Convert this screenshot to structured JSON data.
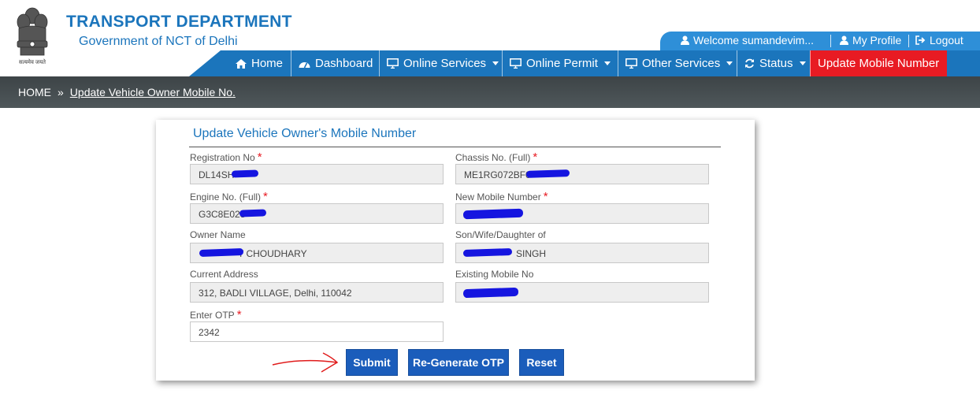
{
  "header": {
    "title": "TRANSPORT DEPARTMENT",
    "subtitle": "Government of NCT of Delhi",
    "emblem_caption": "सत्यमेव जयते"
  },
  "userbar": {
    "welcome": "Welcome  sumandevim...",
    "profile": "My Profile",
    "logout": "Logout"
  },
  "nav": {
    "home": "Home",
    "dashboard": "Dashboard",
    "online_services": "Online Services",
    "online_permit": "Online Permit",
    "other_services": "Other Services",
    "status": "Status",
    "update_mobile": "Update Mobile Number"
  },
  "breadcrumb": {
    "home": "HOME",
    "sep": "»",
    "current": "Update Vehicle Owner Mobile No."
  },
  "form": {
    "title": "Update Vehicle Owner's Mobile Number",
    "required_mark": "*",
    "fields": {
      "registration_no": {
        "label": "Registration No",
        "value": "DL14SH"
      },
      "chassis_no": {
        "label": "Chassis No. (Full)",
        "value": "ME1RG072BF0"
      },
      "engine_no": {
        "label": "Engine No. (Full)",
        "value": "G3C8E023"
      },
      "new_mobile": {
        "label": "New Mobile Number",
        "value": ""
      },
      "owner_name": {
        "label": "Owner Name",
        "value": "T CHOUDHARY"
      },
      "relation_name": {
        "label": "Son/Wife/Daughter of",
        "value": "SINGH"
      },
      "current_address": {
        "label": "Current Address",
        "value": "312, BADLI VILLAGE, Delhi, 110042"
      },
      "existing_mobile": {
        "label": "Existing Mobile No",
        "value": ""
      },
      "otp": {
        "label": "Enter OTP",
        "value": "2342"
      }
    },
    "buttons": {
      "submit": "Submit",
      "regenerate": "Re-Generate OTP",
      "reset": "Reset"
    }
  },
  "colors": {
    "brand_blue": "#1b75bc",
    "active_red": "#e81b23",
    "button_blue": "#1b5dbb",
    "redaction_blue": "#1515e0",
    "annotation_red": "#e01b1b"
  }
}
